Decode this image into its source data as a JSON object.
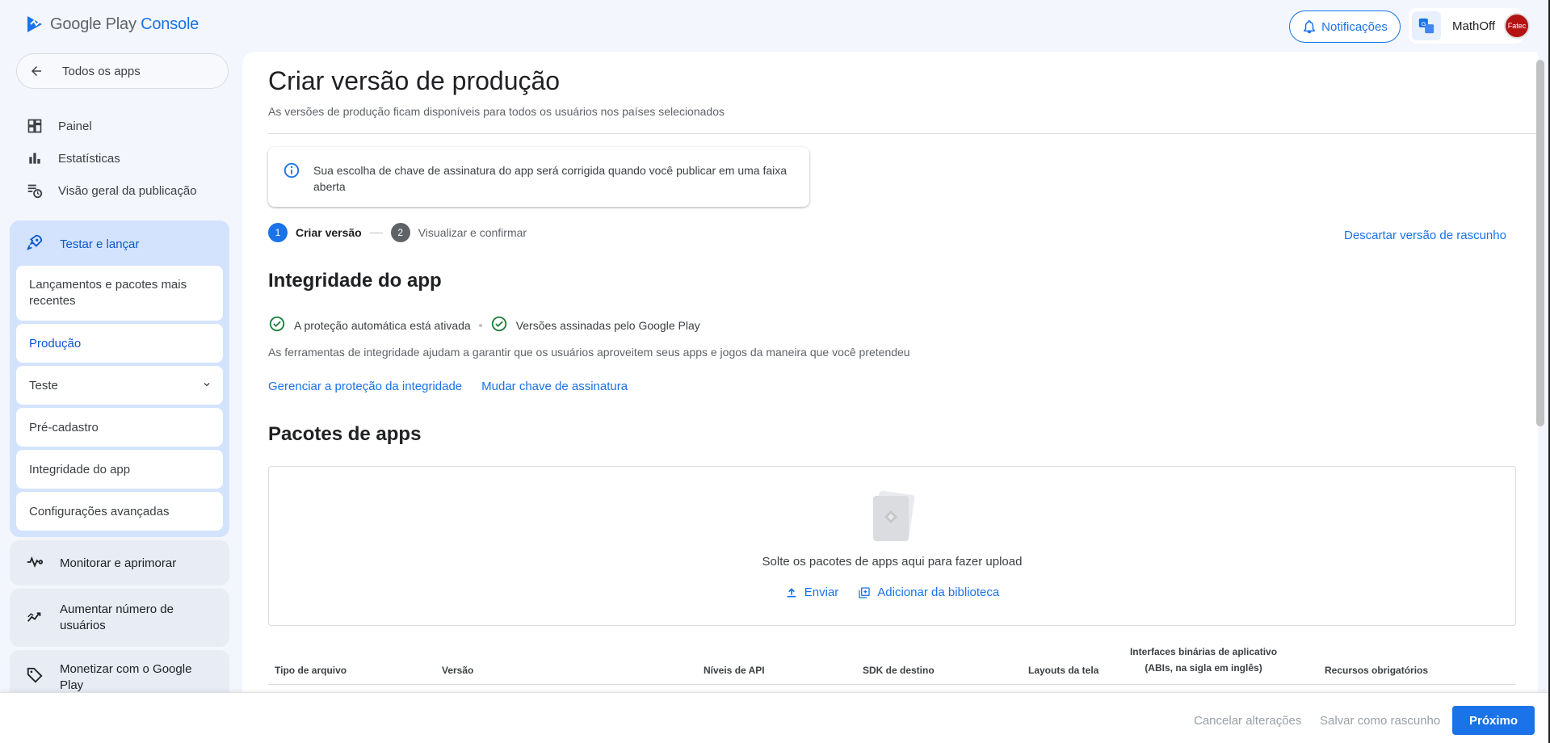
{
  "header": {
    "logo_text": "Google Play",
    "logo_console": "Console",
    "notifications_label": "Notificações",
    "account_name": "MathOff",
    "avatar_text": "Fatec"
  },
  "sidebar": {
    "back_label": "Todos os apps",
    "items": [
      {
        "label": "Painel",
        "icon": "dashboard-icon"
      },
      {
        "label": "Estatísticas",
        "icon": "bar-chart-icon"
      },
      {
        "label": "Visão geral da publicação",
        "icon": "publishing-overview-icon"
      }
    ],
    "group": {
      "label": "Testar e lançar",
      "icon": "rocket-icon",
      "subitems": [
        {
          "label": "Lançamentos e pacotes mais recentes"
        },
        {
          "label": "Produção"
        },
        {
          "label": "Teste"
        },
        {
          "label": "Pré-cadastro"
        },
        {
          "label": "Integridade do app"
        },
        {
          "label": "Configurações avançadas"
        }
      ]
    },
    "cards": [
      {
        "label": "Monitorar e aprimorar",
        "icon": "pulse-icon"
      },
      {
        "label": "Aumentar número de usuários",
        "icon": "growth-icon"
      },
      {
        "label": "Monetizar com o Google Play",
        "icon": "tag-icon"
      }
    ]
  },
  "main": {
    "title": "Criar versão de produção",
    "subtitle": "As versões de produção ficam disponíveis para todos os usuários nos países selecionados",
    "info_text": "Sua escolha de chave de assinatura do app será corrigida quando você publicar em uma faixa aberta",
    "steps": [
      {
        "number": "1",
        "label": "Criar versão"
      },
      {
        "number": "2",
        "label": "Visualizar e confirmar"
      }
    ],
    "discard_label": "Descartar versão de rascunho",
    "integrity": {
      "title": "Integridade do app",
      "check1": "A proteção automática está ativada",
      "check2": "Versões assinadas pelo Google Play",
      "description": "As ferramentas de integridade ajudam a garantir que os usuários aproveitem seus apps e jogos da maneira que você pretendeu",
      "link1": "Gerenciar a proteção da integridade",
      "link2": "Mudar chave de assinatura"
    },
    "bundles": {
      "title": "Pacotes de apps",
      "drop_text": "Solte os pacotes de apps aqui para fazer upload",
      "upload_label": "Enviar",
      "library_label": "Adicionar da biblioteca"
    },
    "table_headers": {
      "file_type": "Tipo de arquivo",
      "version": "Versão",
      "api_levels": "Níveis de API",
      "target_sdk": "SDK de destino",
      "screen_layouts": "Layouts da tela",
      "abis_line1": "Interfaces binárias de aplicativo",
      "abis_line2": "(ABIs, na sigla em inglês)",
      "required_features": "Recursos obrigatórios"
    }
  },
  "footer": {
    "cancel_label": "Cancelar alterações",
    "save_label": "Salvar como rascunho",
    "next_label": "Próximo"
  },
  "colors": {
    "accent": "#1a73e8",
    "nav_group_bg": "#d3e3fd",
    "check_green": "#188038"
  }
}
